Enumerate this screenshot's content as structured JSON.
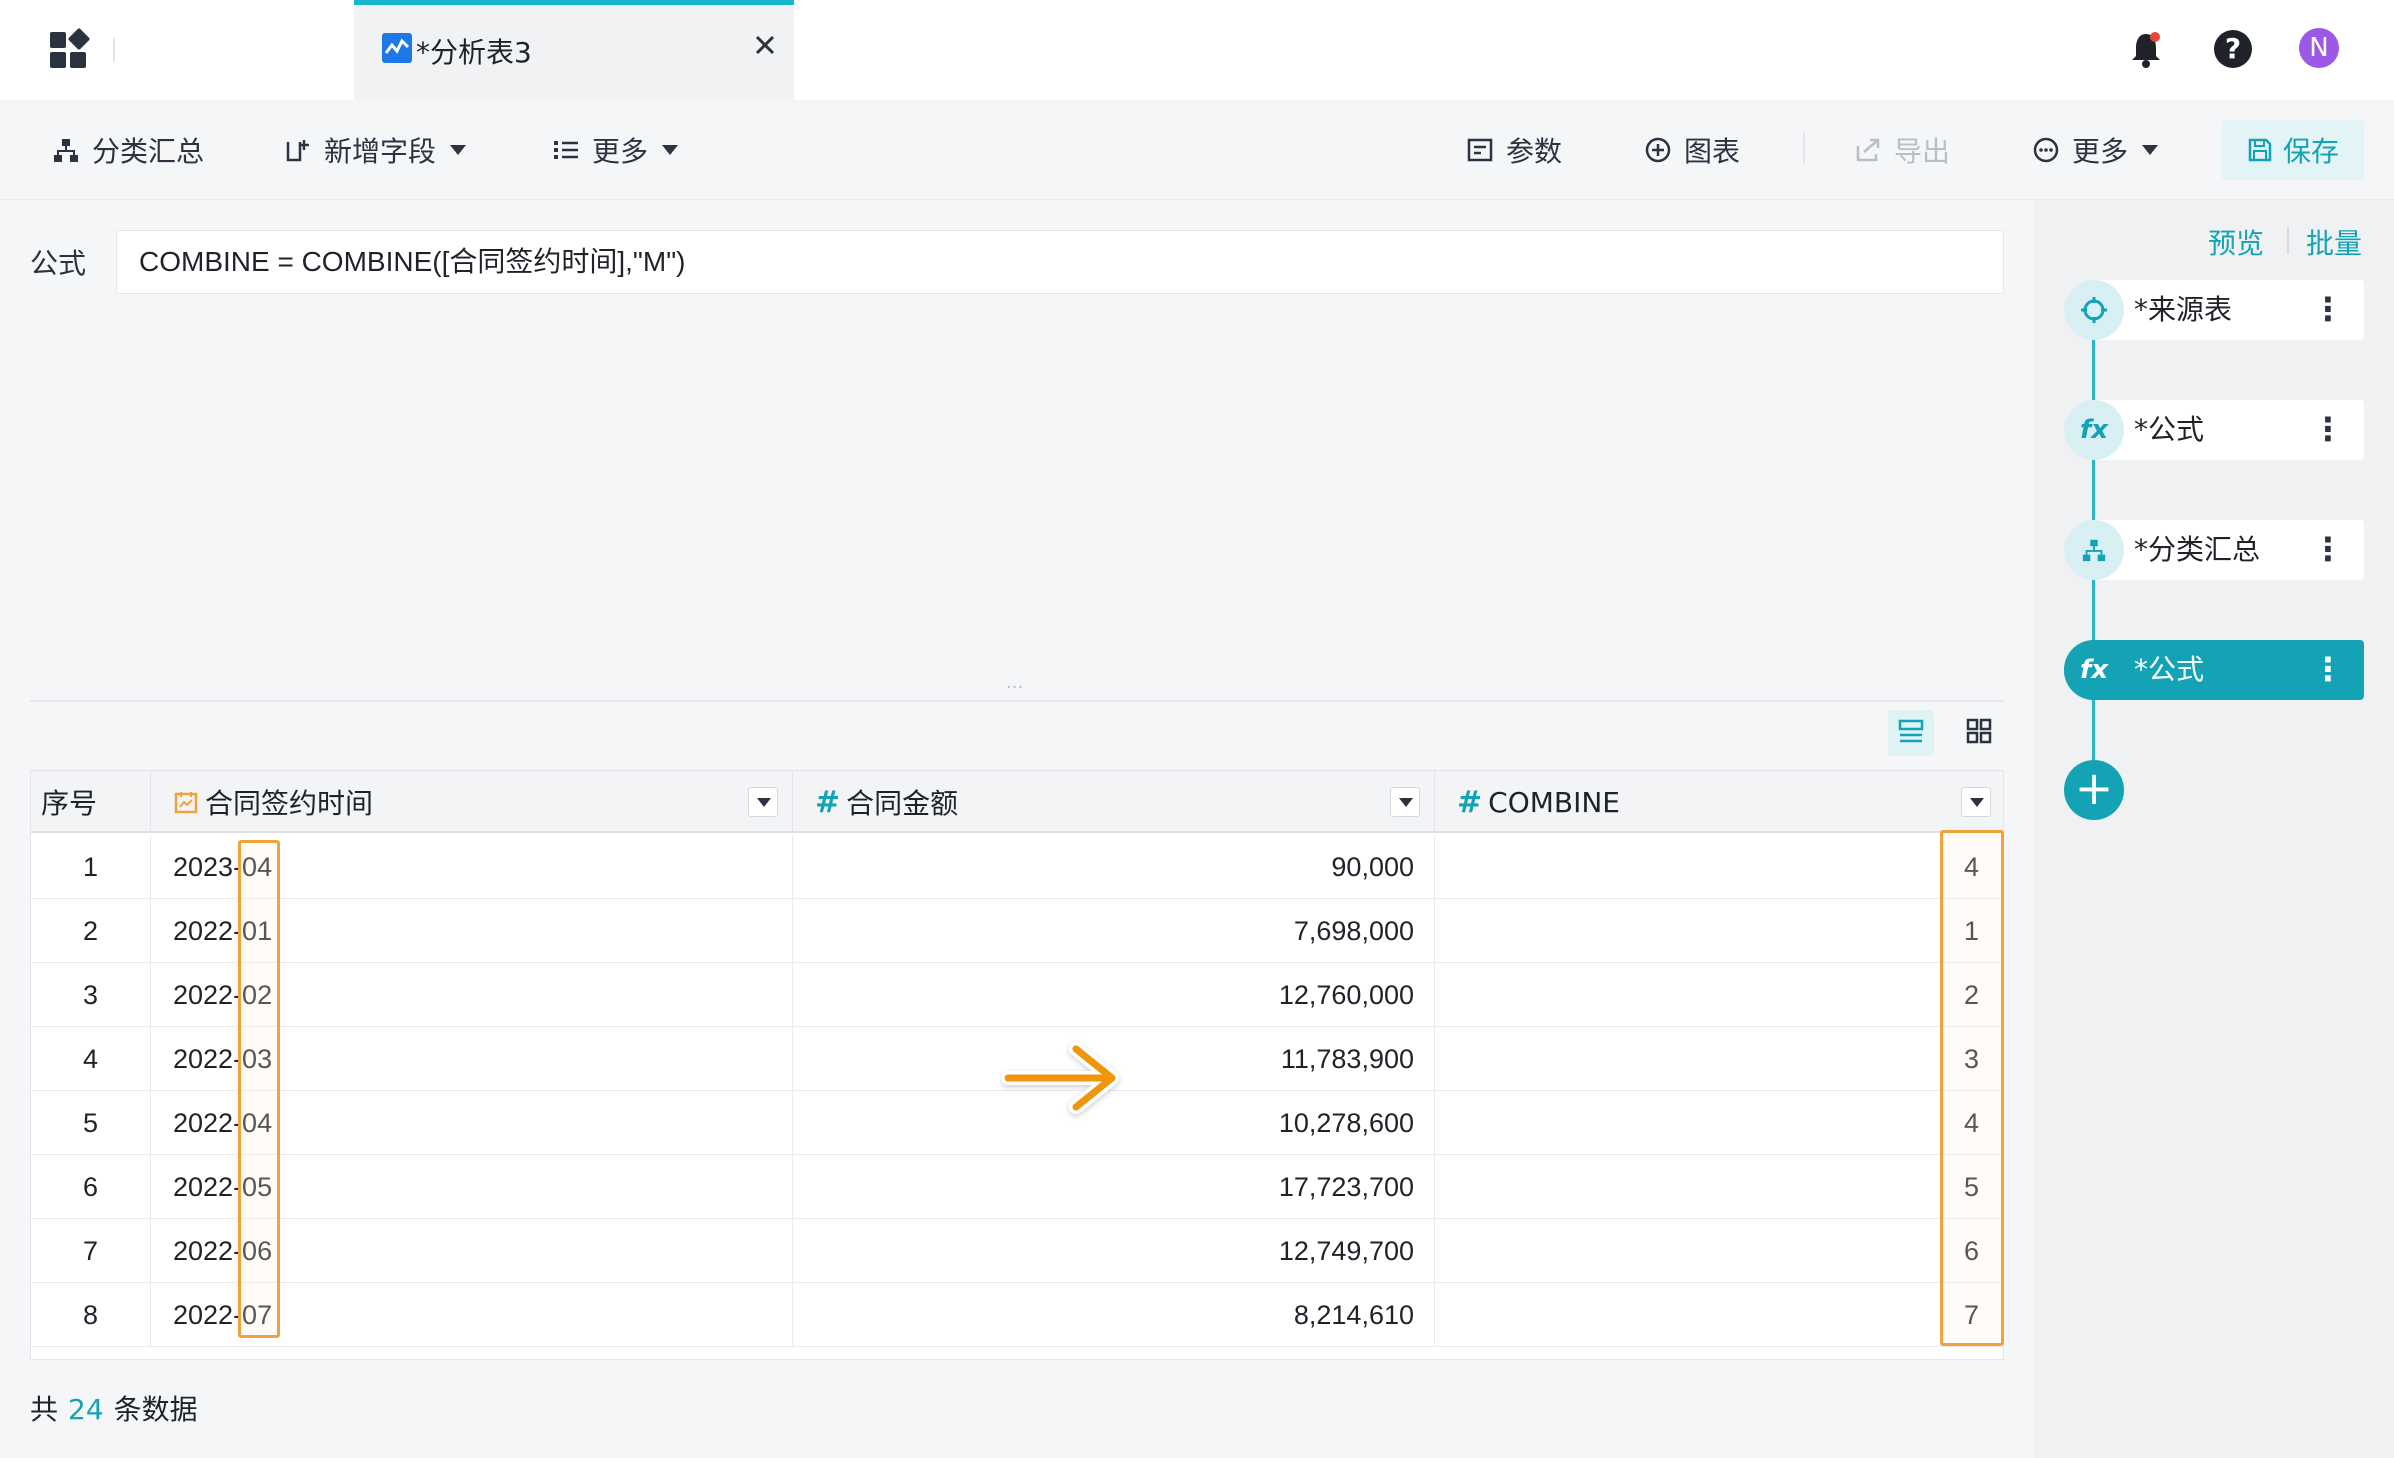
{
  "tab": {
    "title": "*分析表3"
  },
  "user": {
    "avatar_letter": "N"
  },
  "toolbar": {
    "group_summary": "分类汇总",
    "add_field": "新增字段",
    "more_left": "更多",
    "params": "参数",
    "chart": "图表",
    "export": "导出",
    "more_right": "更多",
    "save": "保存"
  },
  "formula": {
    "label": "公式",
    "value": "COMBINE = COMBINE([合同签约时间],\"M\")"
  },
  "resize_handle": "...",
  "table": {
    "columns": [
      "序号",
      "合同签约时间",
      "合同金额",
      "COMBINE"
    ],
    "rows": [
      {
        "seq": "1",
        "date": "2023-04",
        "amount": "90,000",
        "combine": "4"
      },
      {
        "seq": "2",
        "date": "2022-01",
        "amount": "7,698,000",
        "combine": "1"
      },
      {
        "seq": "3",
        "date": "2022-02",
        "amount": "12,760,000",
        "combine": "2"
      },
      {
        "seq": "4",
        "date": "2022-03",
        "amount": "11,783,900",
        "combine": "3"
      },
      {
        "seq": "5",
        "date": "2022-04",
        "amount": "10,278,600",
        "combine": "4"
      },
      {
        "seq": "6",
        "date": "2022-05",
        "amount": "17,723,700",
        "combine": "5"
      },
      {
        "seq": "7",
        "date": "2022-06",
        "amount": "12,749,700",
        "combine": "6"
      },
      {
        "seq": "8",
        "date": "2022-07",
        "amount": "8,214,610",
        "combine": "7"
      }
    ]
  },
  "footer": {
    "prefix": "共",
    "count": "24",
    "suffix": "条数据"
  },
  "panel": {
    "preview": "预览",
    "batch": "批量",
    "steps": [
      {
        "label": "*来源表",
        "icon": "source-icon"
      },
      {
        "label": "*公式",
        "icon": "fx-icon"
      },
      {
        "label": "*分类汇总",
        "icon": "group-icon"
      },
      {
        "label": "*公式",
        "icon": "fx-icon"
      }
    ],
    "fx_text": "fx",
    "add_symbol": "+",
    "kebab": "⋮"
  },
  "colors": {
    "accent": "#14a3b5",
    "highlight": "#f0a23c",
    "tab_border": "#14b8c8"
  }
}
